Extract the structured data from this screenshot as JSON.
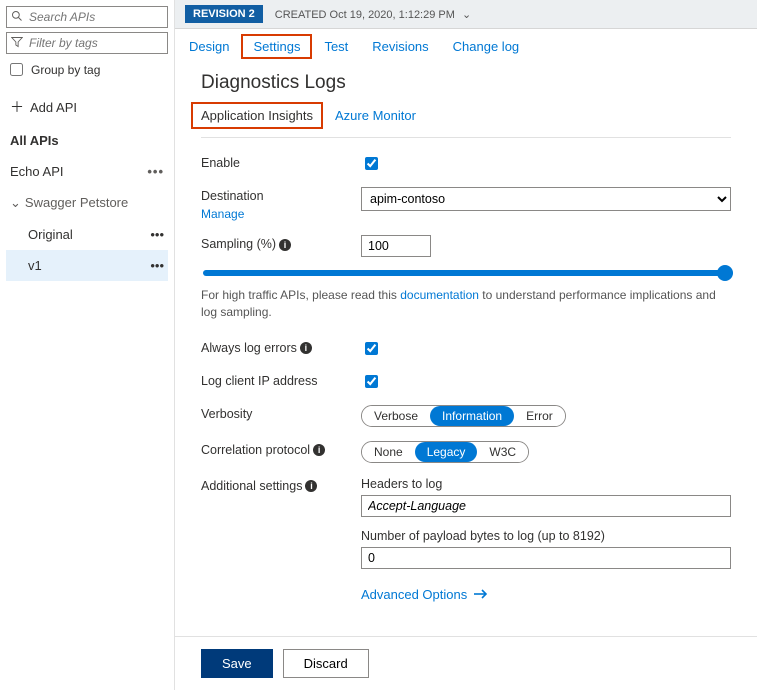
{
  "sidebar": {
    "search_placeholder": "Search APIs",
    "filter_placeholder": "Filter by tags",
    "group_label": "Group by tag",
    "add_label": "Add API",
    "items": {
      "all": "All APIs",
      "echo": "Echo API",
      "swagger": "Swagger Petstore",
      "original": "Original",
      "v1": "v1"
    }
  },
  "header": {
    "revision_badge": "REVISION 2",
    "created": "CREATED Oct 19, 2020, 1:12:29 PM"
  },
  "tabs": {
    "design": "Design",
    "settings": "Settings",
    "test": "Test",
    "revisions": "Revisions",
    "changelog": "Change log"
  },
  "page_title": "Diagnostics Logs",
  "subtabs": {
    "appinsights": "Application Insights",
    "azmon": "Azure Monitor"
  },
  "form": {
    "enable_label": "Enable",
    "destination_label": "Destination",
    "destination_value": "apim-contoso",
    "manage": "Manage",
    "sampling_label": "Sampling (%)",
    "sampling_value": "100",
    "note_prefix": "For high traffic APIs, please read this ",
    "note_link": "documentation",
    "note_suffix": " to understand performance implications and log sampling.",
    "always_log_label": "Always log errors",
    "log_ip_label": "Log client IP address",
    "verbosity_label": "Verbosity",
    "verbosity_options": {
      "a": "Verbose",
      "b": "Information",
      "c": "Error"
    },
    "correlation_label": "Correlation protocol",
    "correlation_options": {
      "a": "None",
      "b": "Legacy",
      "c": "W3C"
    },
    "additional_label": "Additional settings",
    "headers_label": "Headers to log",
    "headers_value": "Accept-Language",
    "payload_label": "Number of payload bytes to log (up to 8192)",
    "payload_value": "0",
    "advanced": "Advanced Options"
  },
  "buttons": {
    "save": "Save",
    "discard": "Discard"
  }
}
